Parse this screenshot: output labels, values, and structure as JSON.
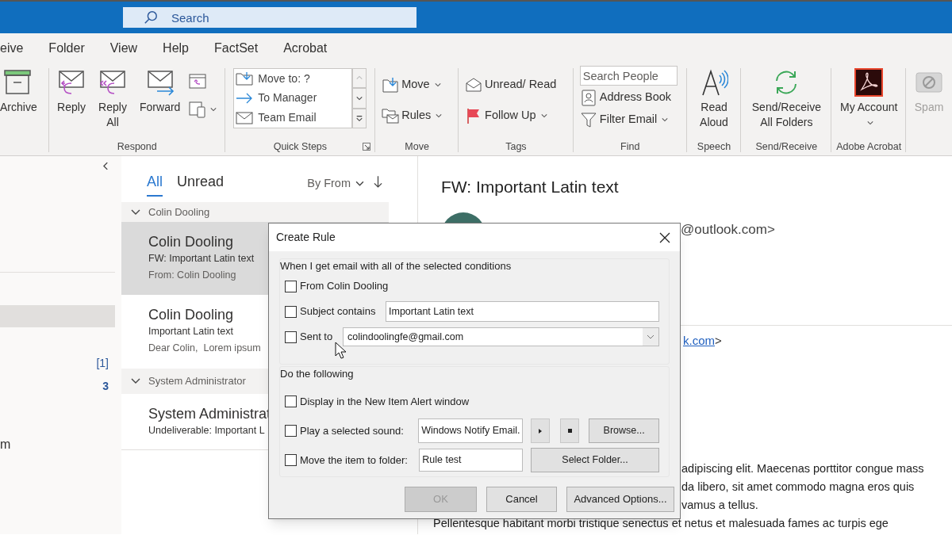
{
  "search": {
    "placeholder": "Search"
  },
  "ribbon_tabs": [
    "eive",
    "Folder",
    "View",
    "Help",
    "FactSet",
    "Acrobat"
  ],
  "ribbon_groups": [
    {
      "commands": [
        {
          "kind": "large",
          "label": "Archive"
        }
      ]
    },
    {
      "label": "Respond",
      "commands": [
        {
          "kind": "large",
          "label": "Reply"
        },
        {
          "kind": "large",
          "label": "Reply All"
        },
        {
          "kind": "large",
          "label": "Forward"
        },
        {
          "kind": "icon_stack"
        }
      ]
    },
    {
      "label": "Quick Steps",
      "launcher": true,
      "commands": [
        {
          "kind": "gallery",
          "items": [
            "Move to: ?",
            "To Manager",
            "Team Email"
          ]
        }
      ]
    },
    {
      "label": "Move",
      "commands": [
        {
          "kind": "small",
          "label": "Move",
          "dropdown": true
        },
        {
          "kind": "small",
          "label": "Rules",
          "dropdown": true
        }
      ]
    },
    {
      "label": "Tags",
      "commands": [
        {
          "kind": "small",
          "label": "Unread/ Read",
          "dropdown": false
        },
        {
          "kind": "small",
          "label": "Follow Up",
          "dropdown": true
        }
      ]
    },
    {
      "label": "Find",
      "commands": [
        {
          "kind": "field",
          "placeholder": "Search People"
        },
        {
          "kind": "small",
          "label": "Address Book",
          "dropdown": false
        },
        {
          "kind": "small",
          "label": "Filter Email",
          "dropdown": true
        }
      ]
    },
    {
      "label": "Speech",
      "commands": [
        {
          "kind": "large",
          "label": "Read Aloud"
        }
      ]
    },
    {
      "label": "Send/Receive",
      "commands": [
        {
          "kind": "large",
          "label": "Send/Receive All Folders"
        }
      ]
    },
    {
      "label": "Adobe Acrobat",
      "commands": [
        {
          "kind": "large",
          "label": "My Account",
          "dropdown": true
        }
      ]
    },
    {
      "commands": [
        {
          "kind": "large",
          "label": "Spam",
          "disabled": true
        }
      ]
    }
  ],
  "folders": [
    {
      "selected": true
    },
    {
      "count": "[1]",
      "unread": false,
      "selected": false
    },
    {
      "count": "3",
      "unread": true,
      "selected": false
    },
    {
      "label": "m",
      "selected": false
    }
  ],
  "message_list": {
    "tabs": [
      {
        "label": "All",
        "selected": true
      },
      {
        "label": "Unread",
        "selected": false
      }
    ],
    "sort": "By From",
    "groups": [
      {
        "header": "Colin Dooling",
        "expanded": true,
        "messages": [
          {
            "sender": "Colin Dooling",
            "subject": "FW: Important Latin text",
            "preview": "From: Colin Dooling",
            "selected": true
          },
          {
            "sender": "Colin Dooling",
            "subject": "Important Latin text",
            "preview": "Dear Colin,  Lorem ipsum",
            "selected": false
          }
        ]
      },
      {
        "header": "System Administrator",
        "expanded": true,
        "messages": [
          {
            "sender": "System Administrat",
            "subject": "Undeliverable: Important L",
            "selected": false
          }
        ]
      }
    ]
  },
  "reading_pane": {
    "title": "FW: Important Latin text",
    "sender_fragment": "@outlook.com>",
    "link_fragment": "k.com",
    "link_suffix": ">",
    "body_fragments": [
      "adipiscing elit. Maecenas porttitor congue mass",
      "da libero, sit amet commodo magna eros quis",
      "vamus a tellus."
    ],
    "body_line": "Pellentesque habitant morbi tristique senectus et netus et malesuada fames ac turpis ege"
  },
  "dialog": {
    "title": "Create Rule",
    "conditions": {
      "heading": "When I get email with all of the selected conditions",
      "rows": [
        {
          "kind": "plain",
          "label": "From Colin Dooling",
          "checked": false
        },
        {
          "kind": "text",
          "label": "Subject contains",
          "checked": false,
          "value": "Important Latin text"
        },
        {
          "kind": "combo",
          "label": "Sent to",
          "checked": false,
          "value": "colindoolingfe@gmail.com"
        }
      ]
    },
    "actions": {
      "heading": "Do the following",
      "rows": [
        {
          "kind": "plain",
          "label": "Display in the New Item Alert window",
          "checked": false
        },
        {
          "kind": "sound",
          "label": "Play a selected sound:",
          "checked": false,
          "value": "Windows Notify Email.",
          "button": "Browse..."
        },
        {
          "kind": "folder",
          "label": "Move the item to folder:",
          "checked": false,
          "value": "Rule test",
          "button": "Select Folder..."
        }
      ]
    },
    "buttons": [
      {
        "label": "OK",
        "disabled": true
      },
      {
        "label": "Cancel",
        "disabled": false
      },
      {
        "label": "Advanced Options...",
        "disabled": false
      }
    ]
  }
}
